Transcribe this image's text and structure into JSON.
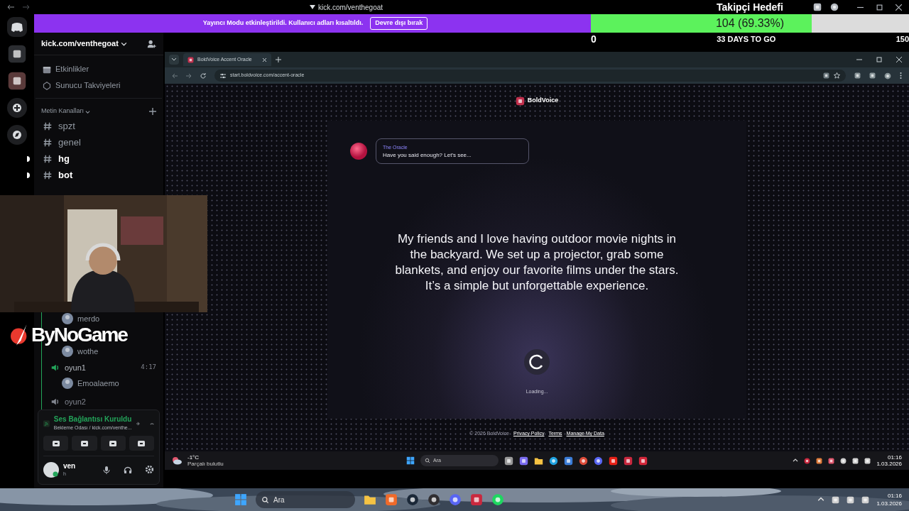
{
  "window": {
    "title": "kick.com/venthegoat"
  },
  "banner": {
    "message": "Yayıncı Modu etkinleştirildi. Kullanıcı adları kısaltıldı.",
    "button": "Devre dışı bırak"
  },
  "follower_goal": {
    "title": "Takipçi Hedefi",
    "progress": "104 (69.33%)",
    "level": 0.6933,
    "start": "0",
    "remaining": "33 DAYS TO GO",
    "target": "150"
  },
  "sidebar": {
    "server_name": "kick.com/venthegoat",
    "items": [
      "Etkinlikler",
      "Sunucu Takviyeleri"
    ],
    "category": "Metin Kanalları",
    "channels": [
      {
        "name": "spzt",
        "unread": false
      },
      {
        "name": "genel",
        "unread": false
      },
      {
        "name": "hg",
        "unread": true
      },
      {
        "name": "bot",
        "unread": true
      }
    ],
    "voice_list": [
      {
        "kind": "user",
        "name": "merdo"
      },
      {
        "kind": "gap"
      },
      {
        "kind": "user",
        "name": "wothe"
      },
      {
        "kind": "channel",
        "name": "oyun1",
        "active": true,
        "timer": "4:17"
      },
      {
        "kind": "user",
        "name": "Emoalaemo"
      },
      {
        "kind": "channel",
        "name": "oyun2",
        "active": false
      }
    ]
  },
  "voice_panel": {
    "status": "Ses Bağlantısı Kuruldu",
    "channel": "Bekleme Odası / kick.com/venthe...",
    "user": "ven",
    "user_status": "h"
  },
  "browser": {
    "tab": "BoldVoice Accent Oracle",
    "url": "start.boldvoice.com/accent-oracle"
  },
  "page": {
    "brand": "BoldVoice",
    "oracle_name": "The Oracle",
    "oracle_message": "Have you said enough? Let's see...",
    "prompt": "My friends and I love having outdoor movie nights in the backyard. We set up a projector, grab some blankets, and enjoy our favorite films under the stars. It’s a simple but unforgettable experience.",
    "loading": "Loading...",
    "copyright": "© 2026 BoldVoice",
    "footer_links": [
      "Privacy Policy",
      "Terms",
      "Manage My Data"
    ]
  },
  "inner_taskbar": {
    "temperature": "-1°C",
    "weather": "Parçalı bulutlu",
    "search": "Ara",
    "time": "01:16",
    "date": "1.03.2026"
  },
  "taskbar": {
    "search": "Ara",
    "time": "01:16",
    "date": "1.03.2026"
  },
  "overlay": {
    "logo": "ByNoGame"
  }
}
